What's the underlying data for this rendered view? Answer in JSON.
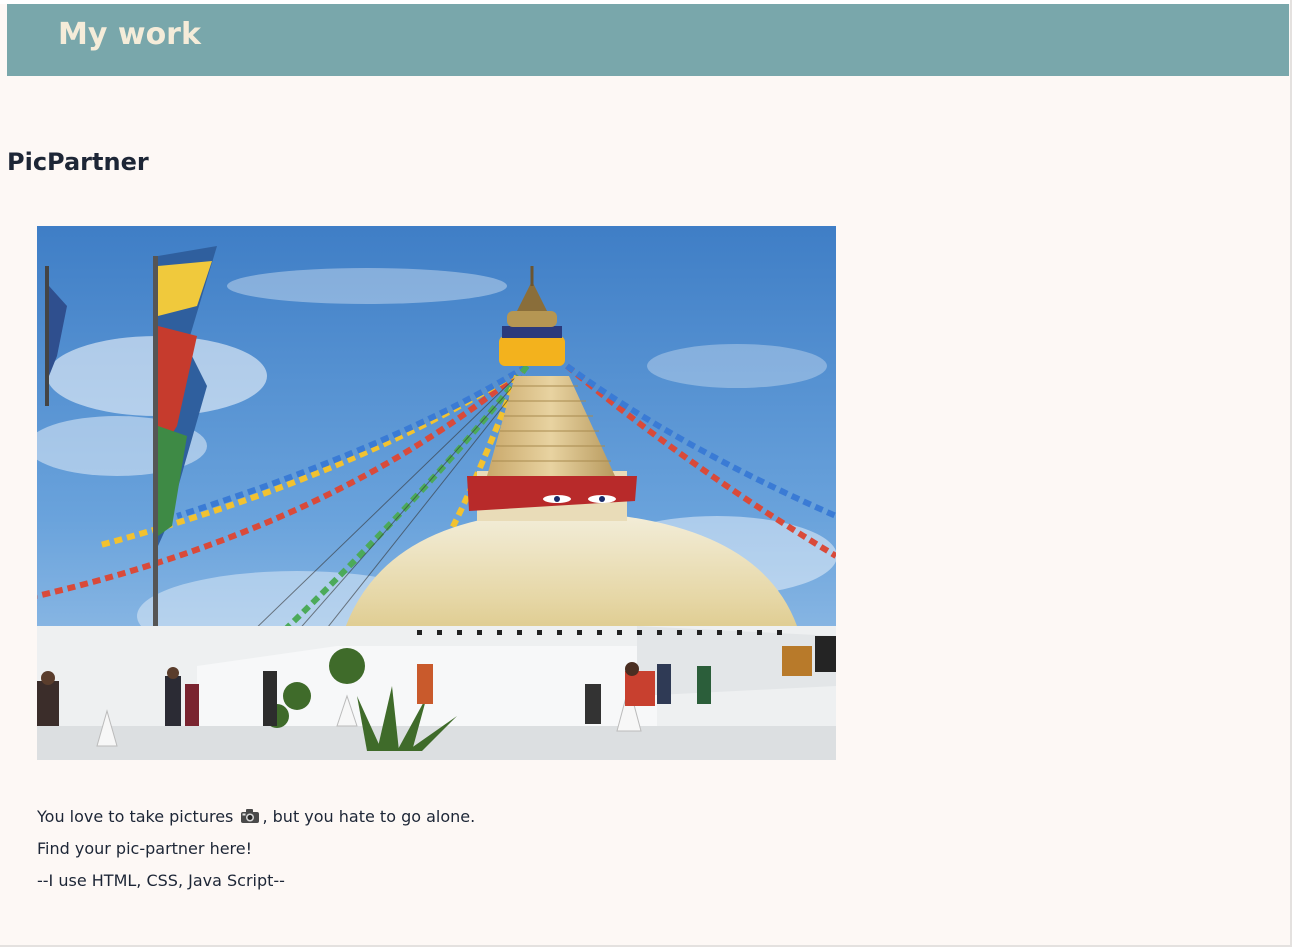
{
  "header": {
    "title": "My work"
  },
  "project": {
    "title": "PicPartner",
    "image_subject": "Boudhanath stupa with prayer flags",
    "description_line1_before_icon": "You love to take pictures",
    "description_line1_icon": "camera-icon",
    "description_line1_after_icon": ", but you hate to go alone.",
    "description_line2": "Find your pic-partner here!",
    "description_line3": "--I use HTML, CSS, Java Script--"
  },
  "colors": {
    "header_background": "#79a7ab",
    "header_text": "#f5ecd9",
    "page_background": "#fdf8f5",
    "body_text": "#1d2636"
  }
}
